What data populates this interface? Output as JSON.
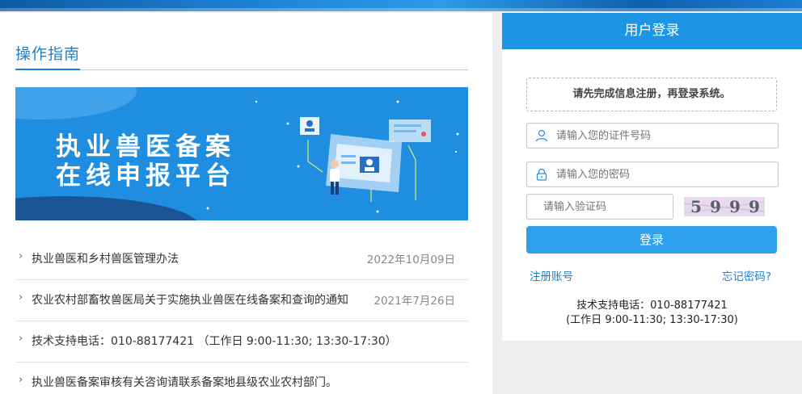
{
  "left": {
    "section_title": "操作指南",
    "hero": {
      "line1": "执业兽医备案",
      "line2": "在线申报平台"
    },
    "news": [
      {
        "text": "执业兽医和乡村兽医管理办法",
        "date": "2022年10月09日"
      },
      {
        "text": "农业农村部畜牧兽医局关于实施执业兽医在线备案和查询的通知",
        "date": "2021年7月26日"
      },
      {
        "text": "技术支持电话：010-88177421 （工作日 9:00-11:30; 13:30-17:30）",
        "date": ""
      },
      {
        "text": "执业兽医备案审核有关咨询请联系备案地县级农业农村部门。",
        "date": ""
      }
    ]
  },
  "login": {
    "title": "用户登录",
    "notice": "请先完成信息注册，再登录系统。",
    "id_placeholder": "请输入您的证件号码",
    "password_placeholder": "请输入您的密码",
    "captcha_placeholder": "请输入验证码",
    "captcha_text": [
      "5",
      "9",
      "9",
      "9"
    ],
    "login_button": "登录",
    "register_link": "注册账号",
    "forgot_link": "忘记密码?",
    "support_line1": "技术支持电话：010-88177421",
    "support_line2": "(工作日 9:00-11:30; 13:30-17:30)"
  },
  "colors": {
    "primary": "#1e95e4",
    "link": "#1e7fcf",
    "hero_bg": "#1f8ee0"
  }
}
